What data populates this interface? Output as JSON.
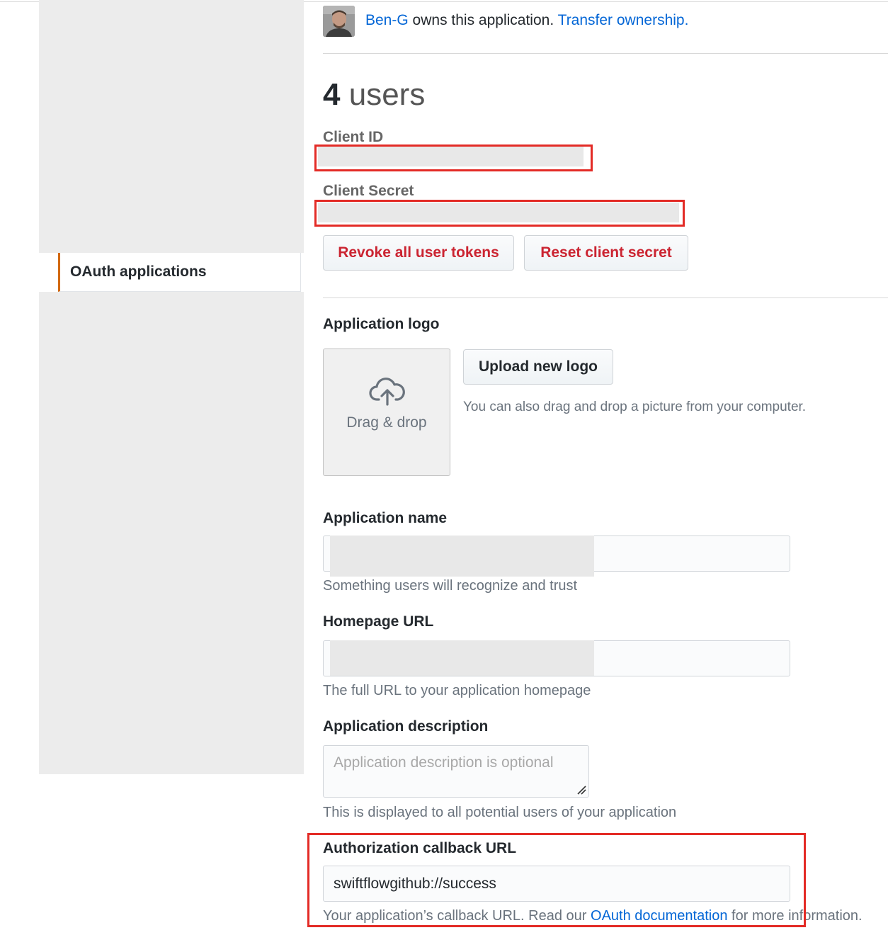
{
  "owner": {
    "name": "Ben-G",
    "text": "owns this application.",
    "transfer_link": "Transfer ownership."
  },
  "users": {
    "count": "4",
    "label": "users"
  },
  "credentials": {
    "client_id_label": "Client ID",
    "client_secret_label": "Client Secret"
  },
  "buttons": {
    "revoke": "Revoke all user tokens",
    "reset": "Reset client secret",
    "upload": "Upload new logo"
  },
  "sidebar": {
    "items": [
      {
        "label": "OAuth applications",
        "selected": true
      }
    ]
  },
  "logo": {
    "label": "Application logo",
    "dropzone": "Drag & drop",
    "hint": "You can also drag and drop a picture from your computer."
  },
  "fields": {
    "app_name": {
      "label": "Application name",
      "value": "",
      "note": "Something users will recognize and trust"
    },
    "homepage": {
      "label": "Homepage URL",
      "value": "",
      "note": "The full URL to your application homepage"
    },
    "description": {
      "label": "Application description",
      "placeholder": "Application description is optional",
      "note": "This is displayed to all potential users of your application"
    },
    "callback": {
      "label": "Authorization callback URL",
      "value": "swiftflowgithub://success",
      "note_prefix": "Your application’s callback URL. Read our",
      "note_link": "OAuth documentation",
      "note_suffix": "for more information."
    }
  },
  "colors": {
    "link": "#0366d6",
    "danger": "#cb2431",
    "highlight_box": "#e32b26",
    "sidebar_accent": "#d26911"
  },
  "icons": {
    "upload": "cloud-upload-icon",
    "resize": "resize-grip-icon"
  }
}
